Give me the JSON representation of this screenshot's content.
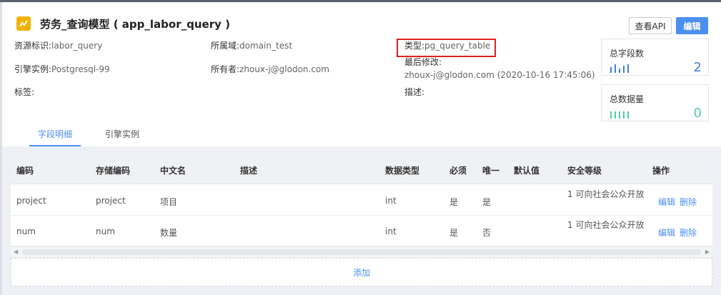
{
  "header": {
    "title": "劳务_查询模型 ( app_labor_query )",
    "view_api_label": "查看API",
    "edit_label": "编辑"
  },
  "meta": {
    "resource_id": {
      "label": "资源标识:",
      "value": "labor_query"
    },
    "domain": {
      "label": "所属域:",
      "value": "domain_test"
    },
    "type": {
      "label": "类型:",
      "value": "pg_query_table"
    },
    "engine_instance": {
      "label": "引擎实例:",
      "value": "Postgresql-99"
    },
    "owner": {
      "label": "所有者:",
      "value": "zhoux-j@glodon.com"
    },
    "last_modified": {
      "label": "最后修改:",
      "value": "zhoux-j@glodon.com (2020-10-16 17:45:06)"
    },
    "tags": {
      "label": "标签:",
      "value": ""
    },
    "description": {
      "label": "描述:",
      "value": ""
    }
  },
  "stats": {
    "field_count": {
      "label": "总字段数",
      "value": "2",
      "color": "#3d7fd9"
    },
    "data_count": {
      "label": "总数据量",
      "value": "0",
      "color": "#4fcf9e"
    }
  },
  "tabs": [
    {
      "label": "字段明细",
      "active": true
    },
    {
      "label": "引擎实例",
      "active": false
    }
  ],
  "table": {
    "columns": [
      "编码",
      "存储编码",
      "中文名",
      "描述",
      "数据类型",
      "必须",
      "唯一",
      "默认值",
      "安全等级",
      "操作"
    ],
    "rows": [
      {
        "code": "project",
        "storage_code": "project",
        "cn_name": "项目",
        "desc": "",
        "data_type": "int",
        "required": "是",
        "unique": "是",
        "default": "",
        "security": "1 可向社会公众开放",
        "edit": "编辑",
        "delete": "删除"
      },
      {
        "code": "num",
        "storage_code": "num",
        "cn_name": "数量",
        "desc": "",
        "data_type": "int",
        "required": "是",
        "unique": "否",
        "default": "",
        "security": "1 可向社会公众开放",
        "edit": "编辑",
        "delete": "删除"
      }
    ]
  },
  "add_label": "添加",
  "colors": {
    "accent": "#4c8ff0",
    "highlight": "#e02020",
    "icon": "#f0b400"
  }
}
